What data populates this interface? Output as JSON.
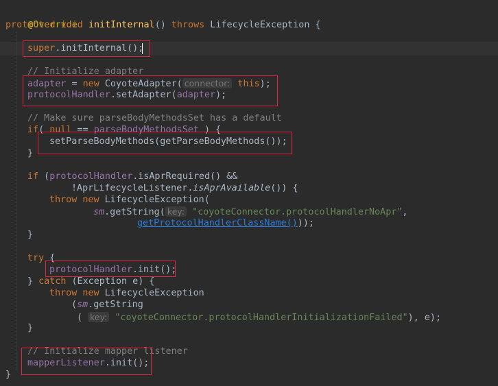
{
  "editor": {
    "language": "Java",
    "theme": "dark",
    "code": {
      "l1": {
        "ann": "@Override"
      },
      "l2": {
        "kw": "protected void",
        "fn": "initInternal",
        "rest": "() ",
        "kw2": "throws",
        "rest2": " LifecycleException {"
      },
      "l3": {
        "kw": "super",
        "rest": ".initInternal();"
      },
      "l4": {
        "cmt": "// Initialize adapter"
      },
      "l5": {
        "fld": "adapter",
        "eq": " = ",
        "kw": "new",
        "rest": " CoyoteAdapter(",
        "hint": "connector:",
        "kw2": "this",
        "end": ");"
      },
      "l6": {
        "fld": "protocolHandler",
        "rest": ".setAdapter(",
        "fld2": "adapter",
        "end": ");"
      },
      "l7": {
        "cmt": "// Make sure parseBodyMethodsSet has a default"
      },
      "l8": {
        "kw": "if",
        "rest": "( ",
        "kw2": "null",
        "op": " == ",
        "fld": "parseBodyMethodsSet",
        "end": " ) {"
      },
      "l9": {
        "text": "setParseBodyMethods(getParseBodyMethods());"
      },
      "l10": {
        "text": "}"
      },
      "l11": {
        "kw": "if",
        "rest": " (",
        "fld": "protocolHandler",
        "end": ".isAprRequired() &&"
      },
      "l12": {
        "pre": "!AprLifecycleListener.",
        "ital": "isAprAvailable",
        "end": "()) {"
      },
      "l13": {
        "kw": "throw new",
        "rest": " LifecycleException("
      },
      "l14": {
        "fld": "sm",
        "rest": ".getString(",
        "hint": "key:",
        "str": "\"coyoteConnector.protocolHandlerNoApr\"",
        "end": ","
      },
      "l15": {
        "link": "getProtocolHandlerClassName()",
        "end": "));"
      },
      "l16": {
        "text": "}"
      },
      "l17": {
        "kw": "try",
        "rest": " {"
      },
      "l18": {
        "fld": "protocolHandler",
        "rest": ".init();"
      },
      "l19": {
        "pre": "} ",
        "kw": "catch",
        "rest": " (Exception e) {"
      },
      "l20": {
        "kw": "throw new",
        "rest": " LifecycleException"
      },
      "l21": {
        "pre": "(",
        "fld": "sm",
        "rest": ".getString"
      },
      "l22": {
        "pre": "(",
        "hint": "key:",
        "str": "\"coyoteConnector.protocolHandlerInitializationFailed\"",
        "end": "), e);"
      },
      "l23": {
        "text": "}"
      },
      "l24": {
        "cmt": "// Initialize mapper listener"
      },
      "l25": {
        "fld": "mapperListener",
        "rest": ".init();"
      },
      "l26": {
        "text": "}"
      }
    }
  },
  "colors": {
    "background": "#2b2b2b",
    "keyword": "#cc7832",
    "method": "#ffc66d",
    "field": "#9876aa",
    "string": "#6a8759",
    "comment": "#808080",
    "annotation": "#bbb529",
    "highlight_box": "#e0263f"
  }
}
